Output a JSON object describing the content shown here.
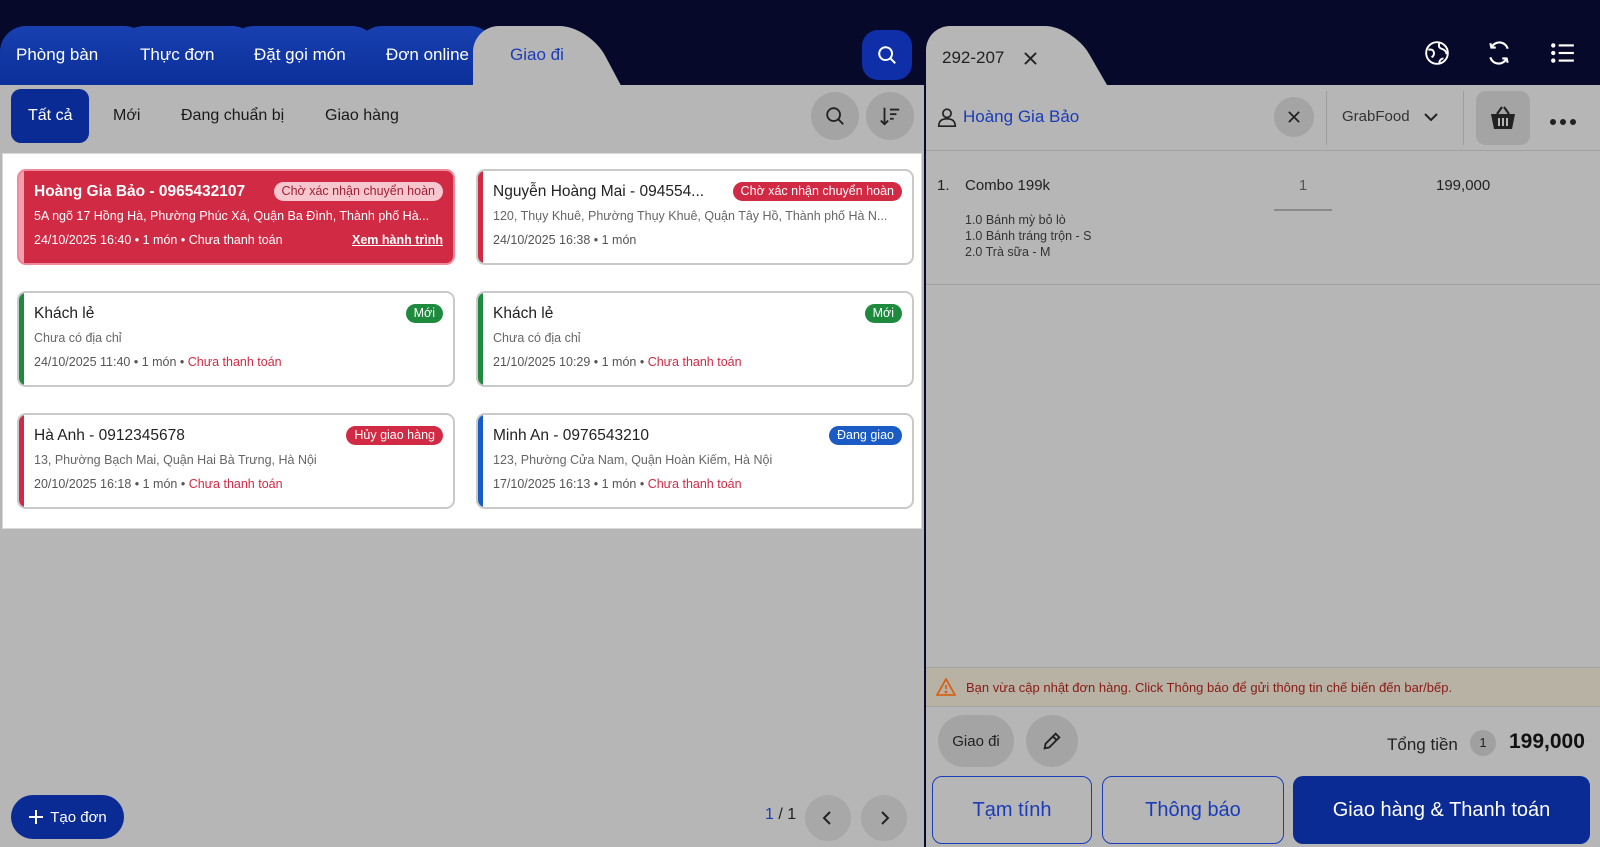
{
  "top_tabs": [
    {
      "label": "Phòng bàn"
    },
    {
      "label": "Thực đơn"
    },
    {
      "label": "Đặt gọi món"
    },
    {
      "label": "Đơn online"
    },
    {
      "label": "Giao đi"
    }
  ],
  "filters": [
    "Tất cả",
    "Mới",
    "Đang chuẩn bị",
    "Giao hàng"
  ],
  "orders": [
    {
      "name": "Hoàng Gia Bảo - 0965432107",
      "badge": "Chờ xác nhận chuyển hoàn",
      "address": "5A ngõ 17 Hồng Hà, Phường Phúc Xá, Quận Ba Đình, Thành phố Hà...",
      "meta": "24/10/2025 16:40 • 1 món • ",
      "payment": "Chưa thanh toán",
      "link": "Xem hành trình",
      "accent": "#f2a0ac"
    },
    {
      "name": "Nguyễn Hoàng Mai - 094554...",
      "badge": "Chờ xác nhận chuyển hoàn",
      "address": "120, Thụy Khuê, Phường Thụy Khuê, Quận Tây Hồ, Thành phố Hà N...",
      "meta": "24/10/2025 16:38 • 1 món",
      "payment": "",
      "accent": "#d12a44",
      "badge_color": "#d12a44"
    },
    {
      "name": "Khách lẻ",
      "badge": "Mới",
      "address": "Chưa có địa chỉ",
      "meta": "24/10/2025 11:40 • 1 món • ",
      "payment": "Chưa thanh toán",
      "accent": "#1e8a3e",
      "badge_color": "#1e8a3e"
    },
    {
      "name": "Khách lẻ",
      "badge": "Mới",
      "address": "Chưa có địa chỉ",
      "meta": "21/10/2025 10:29 • 1 món • ",
      "payment": "Chưa thanh toán",
      "accent": "#1e8a3e",
      "badge_color": "#1e8a3e"
    },
    {
      "name": "Hà Anh - 0912345678",
      "badge": "Hủy giao hàng",
      "address": "13, Phường Bạch Mai, Quận Hai Bà Trưng, Hà Nội",
      "meta": "20/10/2025 16:18 • 1 món • ",
      "payment": "Chưa thanh toán",
      "accent": "#d12a44",
      "badge_color": "#d12a44"
    },
    {
      "name": "Minh An - 0976543210",
      "badge": "Đang giao",
      "address": "123, Phường Cửa Nam, Quận Hoàn Kiếm, Hà Nội",
      "meta": "17/10/2025 16:13 • 1 món • ",
      "payment": "Chưa thanh toán",
      "accent": "#1a5bc4",
      "badge_color": "#1a5bc4"
    }
  ],
  "create_button": "Tạo đơn",
  "pager": {
    "current": "1",
    "separator": " / ",
    "total": "1"
  },
  "order": {
    "tab_label": "292-207",
    "customer": "Hoàng Gia Bảo",
    "source": "GrabFood",
    "items": [
      {
        "no": "1.",
        "name": "Combo 199k",
        "qty": "1",
        "price": "199,000",
        "sub": [
          "1.0 Bánh mỳ bỏ lò",
          "1.0 Bánh tráng trộn - S",
          "2.0 Trà sữa - M"
        ]
      }
    ],
    "notice": "Bạn vừa cập nhật đơn hàng. Click Thông báo để gửi thông tin chế biến đến bar/bếp.",
    "delivery_label": "Giao đi",
    "total_label": "Tổng tiền",
    "total_count": "1",
    "total_value": "199,000",
    "actions": {
      "temp": "Tạm tính",
      "notify": "Thông báo",
      "checkout": "Giao hàng & Thanh toán"
    }
  },
  "colors": {
    "brand": "#0a2a94",
    "danger": "#d12a44",
    "success": "#1e8a3e",
    "info": "#1a5bc4",
    "background": "#06092a"
  },
  "icons": [
    "search-icon",
    "sort-icon",
    "plus-icon",
    "chevron-left-icon",
    "chevron-right-icon",
    "close-icon",
    "globe-icon",
    "refresh-icon",
    "list-icon",
    "user-icon",
    "chevron-down-icon",
    "basket-icon",
    "more-icon",
    "warning-icon",
    "pencil-icon"
  ]
}
